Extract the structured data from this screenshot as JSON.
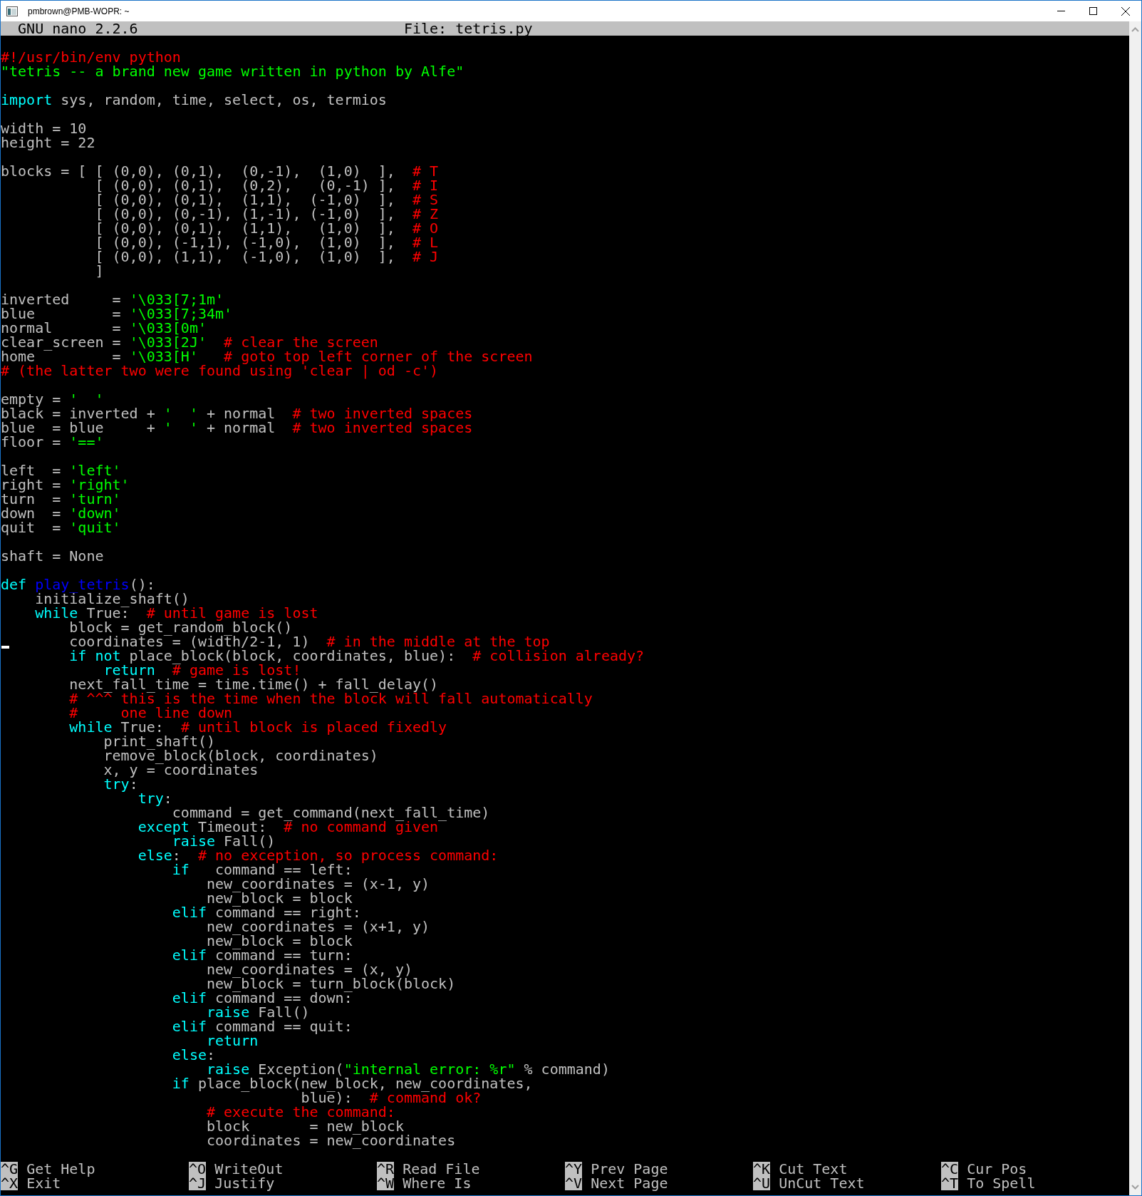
{
  "window": {
    "title": "pmbrown@PMB-WOPR: ~"
  },
  "header": {
    "program": "GNU nano 2.2.6",
    "file": "File: tetris.py"
  },
  "editor": {
    "lines": [
      {
        "kind": "code",
        "spans": [
          {
            "kind": "comment",
            "text": "#!/usr/bin/env python"
          }
        ]
      },
      {
        "kind": "code",
        "spans": [
          {
            "kind": "string",
            "text": "\"tetris -- a brand new game written in python by Alfe\""
          }
        ]
      },
      {
        "kind": "blank"
      },
      {
        "kind": "code",
        "spans": [
          {
            "kind": "keyword",
            "text": "import"
          },
          {
            "kind": "plain",
            "text": " sys, random, time, select, os, termios"
          }
        ]
      },
      {
        "kind": "blank"
      },
      {
        "kind": "code",
        "spans": [
          {
            "kind": "plain",
            "text": "width = 10"
          }
        ]
      },
      {
        "kind": "code",
        "spans": [
          {
            "kind": "plain",
            "text": "height = 22"
          }
        ]
      },
      {
        "kind": "blank"
      },
      {
        "kind": "code",
        "spans": [
          {
            "kind": "plain",
            "text": "blocks = [ [ (0,0), (0,1),  (0,-1),  (1,0)  ],"
          },
          {
            "kind": "comment",
            "text": "  # T"
          }
        ]
      },
      {
        "kind": "code",
        "spans": [
          {
            "kind": "plain",
            "text": "           [ (0,0), (0,1),  (0,2),   (0,-1) ],"
          },
          {
            "kind": "comment",
            "text": "  # I"
          }
        ]
      },
      {
        "kind": "code",
        "spans": [
          {
            "kind": "plain",
            "text": "           [ (0,0), (0,1),  (1,1),  (-1,0)  ],"
          },
          {
            "kind": "comment",
            "text": "  # S"
          }
        ]
      },
      {
        "kind": "code",
        "spans": [
          {
            "kind": "plain",
            "text": "           [ (0,0), (0,-1), (1,-1), (-1,0)  ],"
          },
          {
            "kind": "comment",
            "text": "  # Z"
          }
        ]
      },
      {
        "kind": "code",
        "spans": [
          {
            "kind": "plain",
            "text": "           [ (0,0), (0,1),  (1,1),   (1,0)  ],"
          },
          {
            "kind": "comment",
            "text": "  # O"
          }
        ]
      },
      {
        "kind": "code",
        "spans": [
          {
            "kind": "plain",
            "text": "           [ (0,0), (-1,1), (-1,0),  (1,0)  ],"
          },
          {
            "kind": "comment",
            "text": "  # L"
          }
        ]
      },
      {
        "kind": "code",
        "spans": [
          {
            "kind": "plain",
            "text": "           [ (0,0), (1,1),  (-1,0),  (1,0)  ],"
          },
          {
            "kind": "comment",
            "text": "  # J"
          }
        ]
      },
      {
        "kind": "code",
        "spans": [
          {
            "kind": "plain",
            "text": "           ]"
          }
        ]
      },
      {
        "kind": "blank"
      },
      {
        "kind": "code",
        "spans": [
          {
            "kind": "plain",
            "text": "inverted     = "
          },
          {
            "kind": "string",
            "text": "'\\033[7;1m'"
          }
        ]
      },
      {
        "kind": "code",
        "spans": [
          {
            "kind": "plain",
            "text": "blue         = "
          },
          {
            "kind": "string",
            "text": "'\\033[7;34m'"
          }
        ]
      },
      {
        "kind": "code",
        "spans": [
          {
            "kind": "plain",
            "text": "normal       = "
          },
          {
            "kind": "string",
            "text": "'\\033[0m'"
          }
        ]
      },
      {
        "kind": "code",
        "spans": [
          {
            "kind": "plain",
            "text": "clear_screen = "
          },
          {
            "kind": "string",
            "text": "'\\033[2J'"
          },
          {
            "kind": "comment",
            "text": "  # clear the screen"
          }
        ]
      },
      {
        "kind": "code",
        "spans": [
          {
            "kind": "plain",
            "text": "home         = "
          },
          {
            "kind": "string",
            "text": "'\\033[H'"
          },
          {
            "kind": "comment",
            "text": "   # goto top left corner of the screen"
          }
        ]
      },
      {
        "kind": "code",
        "spans": [
          {
            "kind": "comment",
            "text": "# (the latter two were found using 'clear | od -c')"
          }
        ]
      },
      {
        "kind": "blank"
      },
      {
        "kind": "code",
        "spans": [
          {
            "kind": "plain",
            "text": "empty = "
          },
          {
            "kind": "string",
            "text": "'  '"
          }
        ]
      },
      {
        "kind": "code",
        "spans": [
          {
            "kind": "plain",
            "text": "black = inverted + "
          },
          {
            "kind": "string",
            "text": "'  '"
          },
          {
            "kind": "plain",
            "text": " + normal"
          },
          {
            "kind": "comment",
            "text": "  # two inverted spaces"
          }
        ]
      },
      {
        "kind": "code",
        "spans": [
          {
            "kind": "plain",
            "text": "blue  = blue     + "
          },
          {
            "kind": "string",
            "text": "'  '"
          },
          {
            "kind": "plain",
            "text": " + normal"
          },
          {
            "kind": "comment",
            "text": "  # two inverted spaces"
          }
        ]
      },
      {
        "kind": "code",
        "spans": [
          {
            "kind": "plain",
            "text": "floor = "
          },
          {
            "kind": "string",
            "text": "'=='"
          }
        ]
      },
      {
        "kind": "blank"
      },
      {
        "kind": "code",
        "spans": [
          {
            "kind": "plain",
            "text": "left  = "
          },
          {
            "kind": "string",
            "text": "'left'"
          }
        ]
      },
      {
        "kind": "code",
        "spans": [
          {
            "kind": "plain",
            "text": "right = "
          },
          {
            "kind": "string",
            "text": "'right'"
          }
        ]
      },
      {
        "kind": "code",
        "spans": [
          {
            "kind": "plain",
            "text": "turn  = "
          },
          {
            "kind": "string",
            "text": "'turn'"
          }
        ]
      },
      {
        "kind": "code",
        "spans": [
          {
            "kind": "plain",
            "text": "down  = "
          },
          {
            "kind": "string",
            "text": "'down'"
          }
        ]
      },
      {
        "kind": "code",
        "spans": [
          {
            "kind": "plain",
            "text": "quit  = "
          },
          {
            "kind": "string",
            "text": "'quit'"
          }
        ]
      },
      {
        "kind": "blank"
      },
      {
        "kind": "code",
        "spans": [
          {
            "kind": "plain",
            "text": "shaft = None"
          }
        ]
      },
      {
        "kind": "blank"
      },
      {
        "kind": "code",
        "spans": [
          {
            "kind": "keyword",
            "text": "def"
          },
          {
            "kind": "function",
            "text": " play_tetris"
          },
          {
            "kind": "plain",
            "text": "():"
          }
        ]
      },
      {
        "kind": "code",
        "spans": [
          {
            "kind": "plain",
            "text": "    initialize_shaft()"
          }
        ]
      },
      {
        "kind": "code",
        "spans": [
          {
            "kind": "keyword",
            "text": "    while"
          },
          {
            "kind": "plain",
            "text": " True:"
          },
          {
            "kind": "comment",
            "text": "  # until game is lost"
          }
        ]
      },
      {
        "kind": "code",
        "spans": [
          {
            "kind": "plain",
            "text": "        block = get_random_block()"
          }
        ]
      },
      {
        "kind": "code",
        "cursor": true,
        "spans": [
          {
            "kind": "plain",
            "text": "       coordinates = (width/2-1, 1)"
          },
          {
            "kind": "comment",
            "text": "  # in the middle at the top"
          }
        ]
      },
      {
        "kind": "code",
        "spans": [
          {
            "kind": "keyword",
            "text": "        if not"
          },
          {
            "kind": "plain",
            "text": " place_block(block, coordinates, blue):"
          },
          {
            "kind": "comment",
            "text": "  # collision already?"
          }
        ]
      },
      {
        "kind": "code",
        "spans": [
          {
            "kind": "keyword",
            "text": "            return"
          },
          {
            "kind": "comment",
            "text": "  # game is lost!"
          }
        ]
      },
      {
        "kind": "code",
        "spans": [
          {
            "kind": "plain",
            "text": "        next_fall_time = time.time() + fall_delay()"
          }
        ]
      },
      {
        "kind": "code",
        "spans": [
          {
            "kind": "comment",
            "text": "        # ^^^ this is the time when the block will fall automatically"
          }
        ]
      },
      {
        "kind": "code",
        "spans": [
          {
            "kind": "comment",
            "text": "        #     one line down"
          }
        ]
      },
      {
        "kind": "code",
        "spans": [
          {
            "kind": "keyword",
            "text": "        while"
          },
          {
            "kind": "plain",
            "text": " True:"
          },
          {
            "kind": "comment",
            "text": "  # until block is placed fixedly"
          }
        ]
      },
      {
        "kind": "code",
        "spans": [
          {
            "kind": "plain",
            "text": "            print_shaft()"
          }
        ]
      },
      {
        "kind": "code",
        "spans": [
          {
            "kind": "plain",
            "text": "            remove_block(block, coordinates)"
          }
        ]
      },
      {
        "kind": "code",
        "spans": [
          {
            "kind": "plain",
            "text": "            x, y = coordinates"
          }
        ]
      },
      {
        "kind": "code",
        "spans": [
          {
            "kind": "keyword",
            "text": "            try"
          },
          {
            "kind": "plain",
            "text": ":"
          }
        ]
      },
      {
        "kind": "code",
        "spans": [
          {
            "kind": "keyword",
            "text": "                try"
          },
          {
            "kind": "plain",
            "text": ":"
          }
        ]
      },
      {
        "kind": "code",
        "spans": [
          {
            "kind": "plain",
            "text": "                    command = get_command(next_fall_time)"
          }
        ]
      },
      {
        "kind": "code",
        "spans": [
          {
            "kind": "keyword",
            "text": "                except"
          },
          {
            "kind": "plain",
            "text": " Timeout:"
          },
          {
            "kind": "comment",
            "text": "  # no command given"
          }
        ]
      },
      {
        "kind": "code",
        "spans": [
          {
            "kind": "keyword",
            "text": "                    raise"
          },
          {
            "kind": "plain",
            "text": " Fall()"
          }
        ]
      },
      {
        "kind": "code",
        "spans": [
          {
            "kind": "keyword",
            "text": "                else"
          },
          {
            "kind": "plain",
            "text": ":"
          },
          {
            "kind": "comment",
            "text": "  # no exception, so process command:"
          }
        ]
      },
      {
        "kind": "code",
        "spans": [
          {
            "kind": "keyword",
            "text": "                    if"
          },
          {
            "kind": "plain",
            "text": "   command == left:"
          }
        ]
      },
      {
        "kind": "code",
        "spans": [
          {
            "kind": "plain",
            "text": "                        new_coordinates = (x-1, y)"
          }
        ]
      },
      {
        "kind": "code",
        "spans": [
          {
            "kind": "plain",
            "text": "                        new_block = block"
          }
        ]
      },
      {
        "kind": "code",
        "spans": [
          {
            "kind": "keyword",
            "text": "                    elif"
          },
          {
            "kind": "plain",
            "text": " command == right:"
          }
        ]
      },
      {
        "kind": "code",
        "spans": [
          {
            "kind": "plain",
            "text": "                        new_coordinates = (x+1, y)"
          }
        ]
      },
      {
        "kind": "code",
        "spans": [
          {
            "kind": "plain",
            "text": "                        new_block = block"
          }
        ]
      },
      {
        "kind": "code",
        "spans": [
          {
            "kind": "keyword",
            "text": "                    elif"
          },
          {
            "kind": "plain",
            "text": " command == turn:"
          }
        ]
      },
      {
        "kind": "code",
        "spans": [
          {
            "kind": "plain",
            "text": "                        new_coordinates = (x, y)"
          }
        ]
      },
      {
        "kind": "code",
        "spans": [
          {
            "kind": "plain",
            "text": "                        new_block = turn_block(block)"
          }
        ]
      },
      {
        "kind": "code",
        "spans": [
          {
            "kind": "keyword",
            "text": "                    elif"
          },
          {
            "kind": "plain",
            "text": " command == down:"
          }
        ]
      },
      {
        "kind": "code",
        "spans": [
          {
            "kind": "keyword",
            "text": "                        raise"
          },
          {
            "kind": "plain",
            "text": " Fall()"
          }
        ]
      },
      {
        "kind": "code",
        "spans": [
          {
            "kind": "keyword",
            "text": "                    elif"
          },
          {
            "kind": "plain",
            "text": " command == quit:"
          }
        ]
      },
      {
        "kind": "code",
        "spans": [
          {
            "kind": "keyword",
            "text": "                        return"
          }
        ]
      },
      {
        "kind": "code",
        "spans": [
          {
            "kind": "keyword",
            "text": "                    else"
          },
          {
            "kind": "plain",
            "text": ":"
          }
        ]
      },
      {
        "kind": "code",
        "spans": [
          {
            "kind": "keyword",
            "text": "                        raise"
          },
          {
            "kind": "plain",
            "text": " Exception("
          },
          {
            "kind": "string",
            "text": "\"internal error: %r\""
          },
          {
            "kind": "plain",
            "text": " % command)"
          }
        ]
      },
      {
        "kind": "code",
        "spans": [
          {
            "kind": "keyword",
            "text": "                    if"
          },
          {
            "kind": "plain",
            "text": " place_block(new_block, new_coordinates,"
          }
        ]
      },
      {
        "kind": "code",
        "spans": [
          {
            "kind": "plain",
            "text": "                                   blue):"
          },
          {
            "kind": "comment",
            "text": "  # command ok?"
          }
        ]
      },
      {
        "kind": "code",
        "spans": [
          {
            "kind": "comment",
            "text": "                        # execute the command:"
          }
        ]
      },
      {
        "kind": "code",
        "spans": [
          {
            "kind": "plain",
            "text": "                        block       = new_block"
          }
        ]
      },
      {
        "kind": "code",
        "spans": [
          {
            "kind": "plain",
            "text": "                        coordinates = new_coordinates"
          }
        ]
      }
    ]
  },
  "shortcuts": [
    [
      {
        "key": "^G",
        "label": "Get Help"
      },
      {
        "key": "^X",
        "label": "Exit"
      }
    ],
    [
      {
        "key": "^O",
        "label": "WriteOut"
      },
      {
        "key": "^J",
        "label": "Justify"
      }
    ],
    [
      {
        "key": "^R",
        "label": "Read File"
      },
      {
        "key": "^W",
        "label": "Where Is"
      }
    ],
    [
      {
        "key": "^Y",
        "label": "Prev Page"
      },
      {
        "key": "^V",
        "label": "Next Page"
      }
    ],
    [
      {
        "key": "^K",
        "label": "Cut Text"
      },
      {
        "key": "^U",
        "label": "UnCut Text"
      }
    ],
    [
      {
        "key": "^C",
        "label": "Cur Pos"
      },
      {
        "key": "^T",
        "label": "To Spell"
      }
    ]
  ]
}
